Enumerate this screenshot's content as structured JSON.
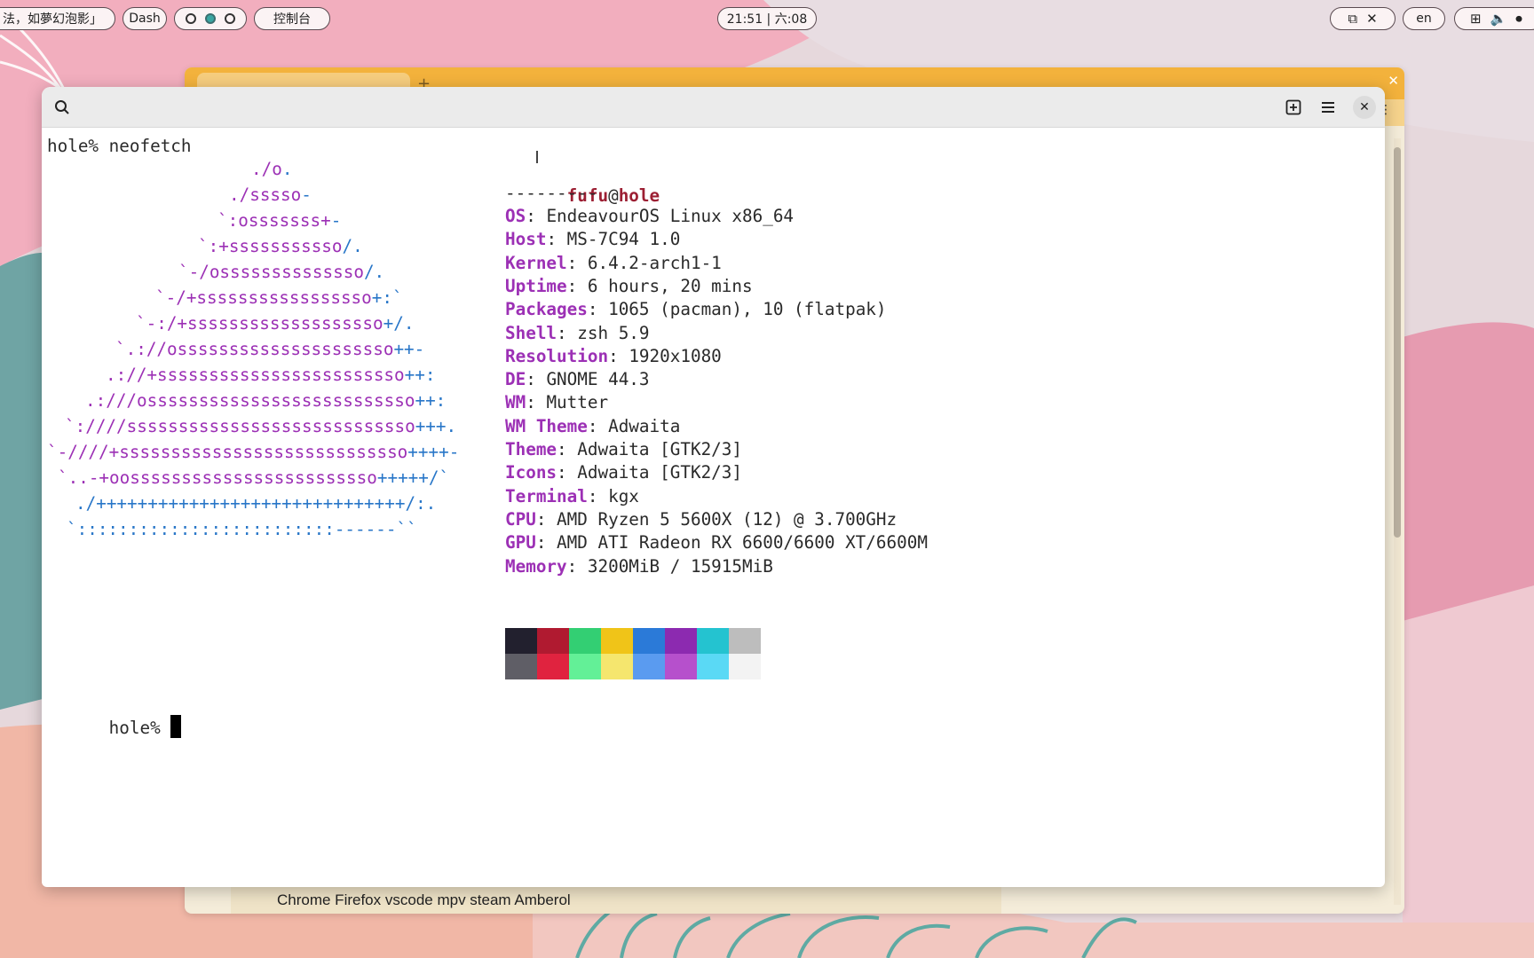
{
  "topbar": {
    "left_text": "法，如夢幻泡影」",
    "dash_label": "Dash",
    "console_label": "控制台",
    "clock": "21:51 | 六:08",
    "lang": "en",
    "screenshot_close": "✕"
  },
  "background_window": {
    "bookmarks": "Chrome Firefox vscode mpv steam Amberol"
  },
  "terminal": {
    "prompt1": "hole% neofetch",
    "user": "fufu",
    "at": "@",
    "host": "hole",
    "separator": "---------",
    "info": [
      {
        "key": "OS",
        "value": "EndeavourOS Linux x86_64"
      },
      {
        "key": "Host",
        "value": "MS-7C94 1.0"
      },
      {
        "key": "Kernel",
        "value": "6.4.2-arch1-1"
      },
      {
        "key": "Uptime",
        "value": "6 hours, 20 mins"
      },
      {
        "key": "Packages",
        "value": "1065 (pacman), 10 (flatpak)"
      },
      {
        "key": "Shell",
        "value": "zsh 5.9"
      },
      {
        "key": "Resolution",
        "value": "1920x1080"
      },
      {
        "key": "DE",
        "value": "GNOME 44.3"
      },
      {
        "key": "WM",
        "value": "Mutter"
      },
      {
        "key": "WM Theme",
        "value": "Adwaita"
      },
      {
        "key": "Theme",
        "value": "Adwaita [GTK2/3]"
      },
      {
        "key": "Icons",
        "value": "Adwaita [GTK2/3]"
      },
      {
        "key": "Terminal",
        "value": "kgx"
      },
      {
        "key": "CPU",
        "value": "AMD Ryzen 5 5600X (12) @ 3.700GHz"
      },
      {
        "key": "GPU",
        "value": "AMD ATI Radeon RX 6600/6600 XT/6600M"
      },
      {
        "key": "Memory",
        "value": "3200MiB / 15915MiB"
      }
    ],
    "logo": [
      {
        "p": "./o",
        "b": "."
      },
      {
        "p": "./sssso",
        "b": "-"
      },
      {
        "p": "`:osssssss+",
        "b": "-"
      },
      {
        "p": "`:+sssssssssso",
        "b": "/."
      },
      {
        "p": "`-/ossssssssssssso",
        "b": "/."
      },
      {
        "p": "`-/+sssssssssssssssso",
        "b": "+:`"
      },
      {
        "p": "`-:/+sssssssssssssssssso",
        "b": "+/."
      },
      {
        "p": "`.://osssssssssssssssssssso",
        "b": "++-"
      },
      {
        "p": ".://+ssssssssssssssssssssssso",
        "b": "++:"
      },
      {
        "p": ".:///ossssssssssssssssssssssssso",
        "b": "++:"
      },
      {
        "p": "`:////ssssssssssssssssssssssssssso",
        "b": "+++."
      },
      {
        "p": "`-////+ssssssssssssssssssssssssssso",
        "b": "++++-"
      },
      {
        "p": "`..-+oossssssssssssssssssssssso",
        "b": "+++++/`"
      },
      {
        "p": "",
        "b": "./++++++++++++++++++++++++++++++/:."
      },
      {
        "p": "",
        "b": "`:::::::::::::::::::::::::------``"
      }
    ],
    "palette_top": [
      "#22202e",
      "#b01a30",
      "#33cf73",
      "#f0c418",
      "#2b7ad8",
      "#8c2ab0",
      "#24c3d0",
      "#bdbdbd"
    ],
    "palette_bottom": [
      "#5f5e66",
      "#e0233f",
      "#63f097",
      "#f5e66e",
      "#5a9bf0",
      "#b650cc",
      "#5ad9f5",
      "#f3f3f3"
    ],
    "prompt2": "hole% "
  }
}
